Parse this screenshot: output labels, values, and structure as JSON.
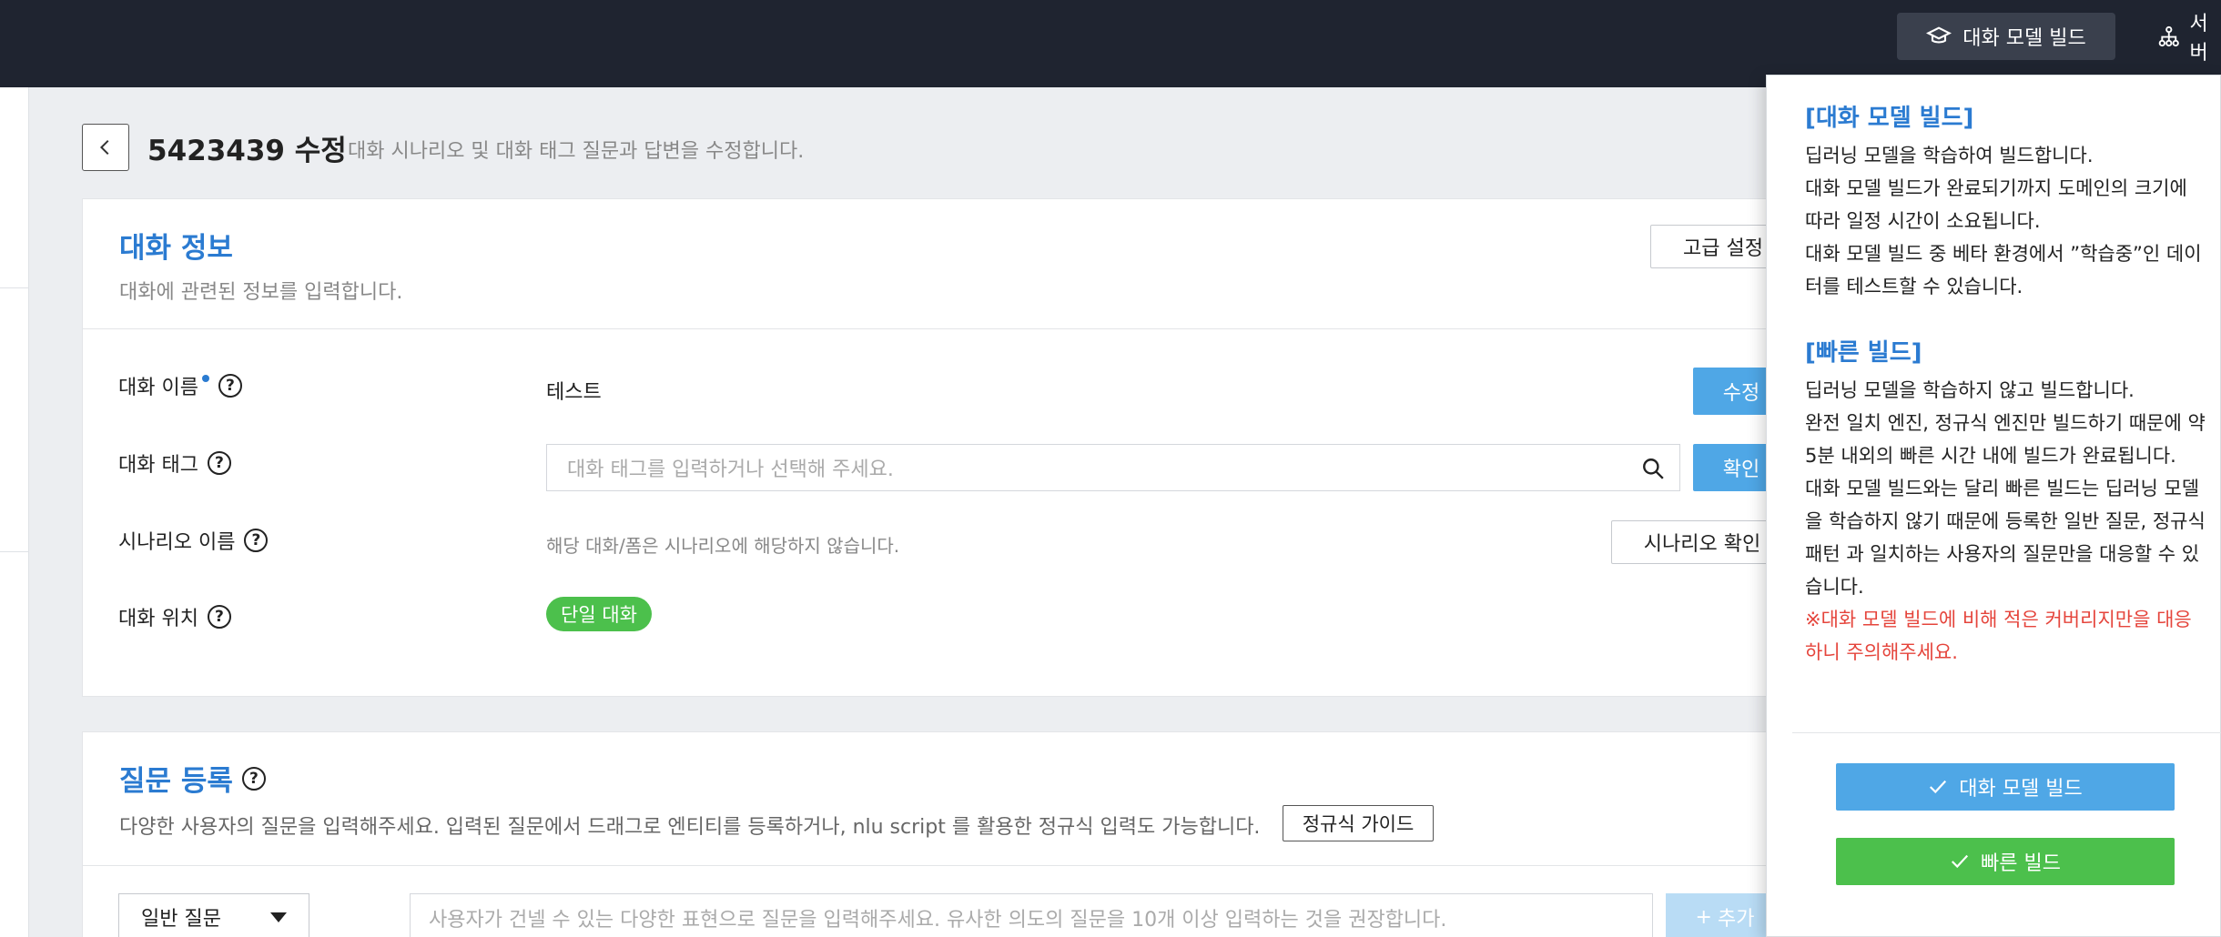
{
  "topbar": {
    "build_button_label": "대화 모델 빌드",
    "server_label": "서버"
  },
  "header": {
    "title": "5423439 수정",
    "description": "대화 시나리오 및 대화 태그 질문과 답변을 수정합니다."
  },
  "dialog_info": {
    "title": "대화 정보",
    "description": "대화에 관련된 정보를 입력합니다.",
    "advanced_button": "고급 설정",
    "rows": {
      "name": {
        "label": "대화 이름",
        "value": "테스트",
        "button": "수정"
      },
      "tag": {
        "label": "대화 태그",
        "placeholder": "대화 태그를 입력하거나 선택해 주세요.",
        "button": "확인"
      },
      "scenario": {
        "label": "시나리오 이름",
        "value": "해당 대화/폼은 시나리오에 해당하지 않습니다.",
        "button": "시나리오 확인"
      },
      "position": {
        "label": "대화 위치",
        "badge": "단일 대화"
      }
    }
  },
  "question": {
    "title": "질문 등록",
    "description": "다양한 사용자의 질문을 입력해주세요. 입력된 질문에서 드래그로 엔티티를 등록하거나, nlu script 를 활용한 정규식 입력도 가능합니다.",
    "regex_guide_button": "정규식 가이드",
    "type_select": "일반 질문",
    "input_placeholder": "사용자가 건넬 수 있는 다양한 표현으로 질문을 입력해주세요. 유사한 의도의 질문을 10개 이상 입력하는 것을 권장합니다.",
    "add_button": "추가"
  },
  "popover": {
    "model_heading": "[대화 모델 빌드]",
    "model_lines": [
      "딥러닝 모델을 학습하여 빌드합니다.",
      "대화 모델 빌드가 완료되기까지 도메인의 크기에 따라 일정 시간이 소요됩니다.",
      "대화 모델 빌드 중 베타 환경에서 ”학습중”인 데이터를 테스트할 수 있습니다."
    ],
    "fast_heading": "[빠른 빌드]",
    "fast_lines": [
      "딥러닝 모델을 학습하지 않고 빌드합니다.",
      "완전 일치 엔진, 정규식 엔진만 빌드하기 때문에 약 5분 내외의 빠른 시간 내에 빌드가 완료됩니다.",
      "대화 모델 빌드와는 달리 빠른 빌드는 딥러닝 모델을 학습하지 않기 때문에 등록한 일반 질문, 정규식 패턴 과 일치하는 사용자의 질문만을 대응할 수 있습니다."
    ],
    "warning": "※대화 모델 빌드에 비해 적은 커버리지만을 대응하니 주의해주세요.",
    "model_build_button": "대화 모델 빌드",
    "fast_build_button": "빠른 빌드"
  },
  "colors": {
    "accent_blue": "#2b7bd1",
    "button_blue": "#4fa7e6",
    "green": "#4cc04c",
    "warning_red": "#e5453c",
    "topbar": "#1f2430"
  }
}
